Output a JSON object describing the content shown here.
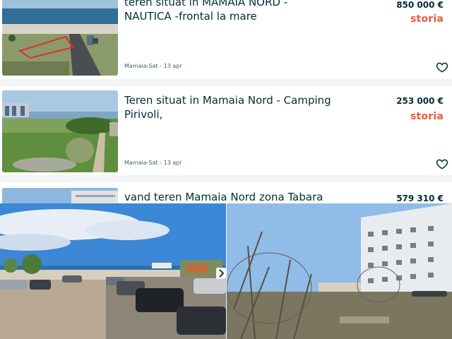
{
  "listings": [
    {
      "title": "teren situat in MAMAIA NORD - NAUTICA -frontal la mare",
      "price": "850 000 €",
      "brand": "storia",
      "location_date": "Mamaia-Sat - 13 apr"
    },
    {
      "title": "Teren situat in Mamaia Nord - Camping Pirivoli,",
      "price": "253 000 €",
      "brand": "storia",
      "location_date": "Mamaia-Sat - 13 apr"
    },
    {
      "title": "vand teren Mamaia Nord zona Tabara",
      "price": "579 310 €"
    }
  ],
  "icons": {
    "favorite": "heart-outline-icon",
    "gallery_next": "chevron-right-icon"
  },
  "colors": {
    "text": "#002f34",
    "brand": "#f1573b",
    "brand_accent": "#2b7ae6",
    "background": "#f2f4f5"
  }
}
